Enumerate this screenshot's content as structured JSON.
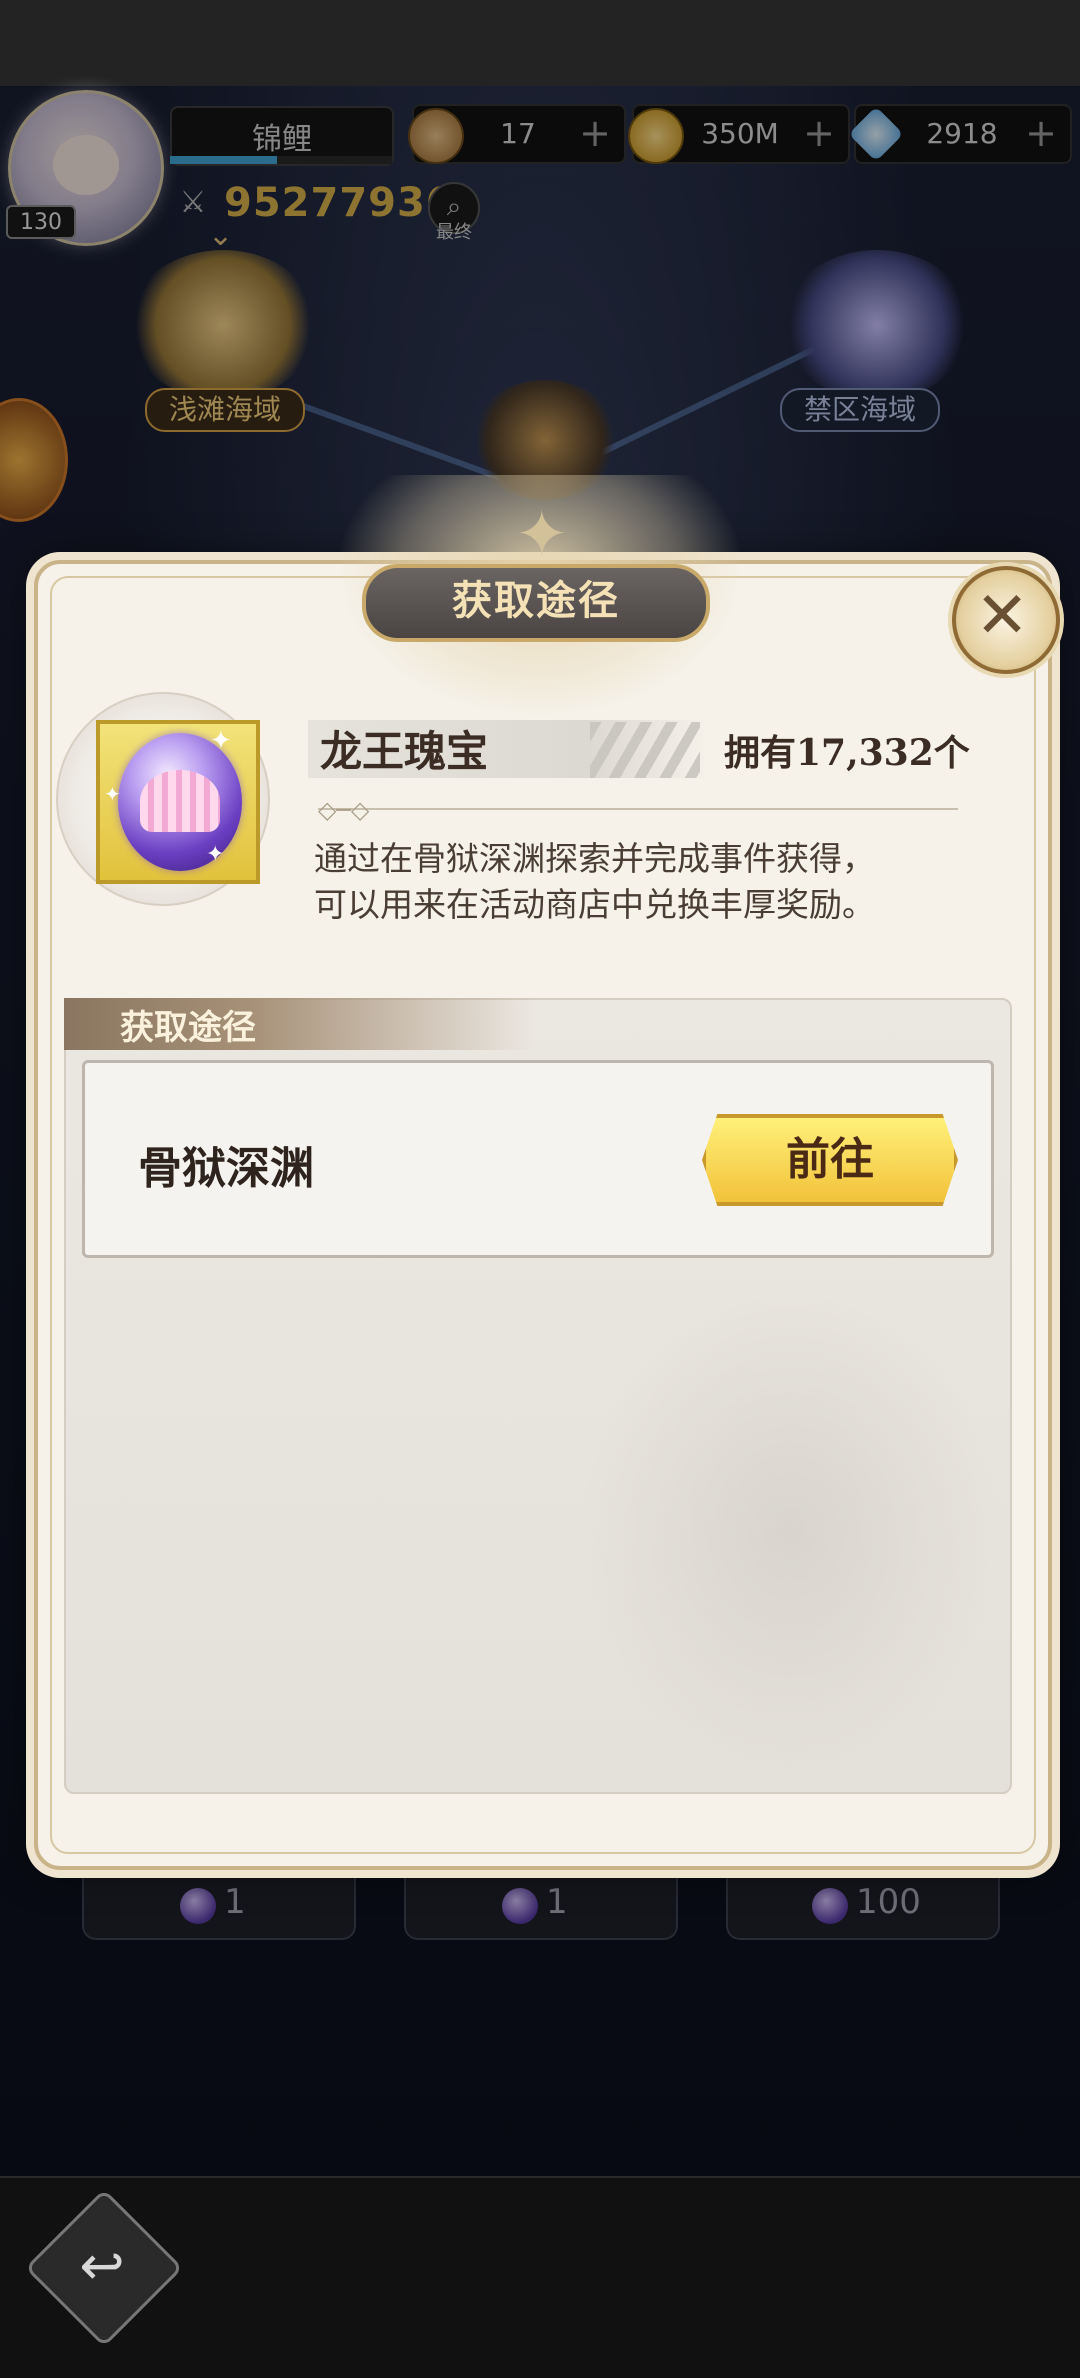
{
  "player": {
    "name": "锦鲤",
    "level": "130",
    "power": "95277936",
    "search_label": "最终",
    "exp_fraction": 0.48
  },
  "resources": [
    {
      "icon": "bronze-coin-icon",
      "value": "17",
      "plus": "+"
    },
    {
      "icon": "gold-coin-icon",
      "value": "350M",
      "plus": "+"
    },
    {
      "icon": "diamond-icon",
      "value": "2918",
      "plus": "+"
    }
  ],
  "map": {
    "node_left_label": "浅滩海域",
    "node_right_label": "禁区海域"
  },
  "modal": {
    "title": "获取途径",
    "close_icon": "✕",
    "item": {
      "name": "龙王瑰宝",
      "owned": "拥有17,332个",
      "description_line1": "通过在骨狱深渊探索并完成事件获得，",
      "description_line2": "可以用来在活动商店中兑换丰厚奖励。"
    },
    "section_header": "获取途径",
    "routes": [
      {
        "name": "骨狱深渊",
        "button": "前往"
      }
    ]
  },
  "bottom_costs": [
    {
      "value": "1"
    },
    {
      "value": "1"
    },
    {
      "value": "100"
    }
  ],
  "colors": {
    "accent_gold": "#f2c23a",
    "power_gold": "#d9b34a",
    "modal_bg": "#f6f2ea"
  }
}
